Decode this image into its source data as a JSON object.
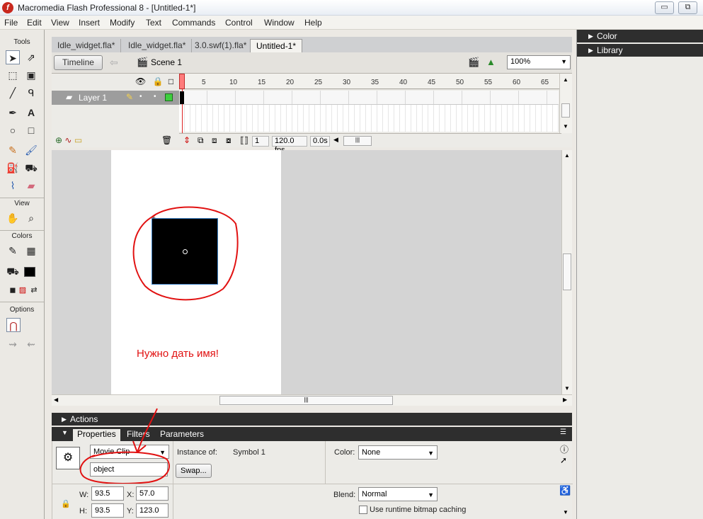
{
  "window": {
    "title": "Macromedia Flash Professional 8 - [Untitled-1*]",
    "controls": [
      "▭",
      "⧉"
    ]
  },
  "menu": [
    "File",
    "Edit",
    "View",
    "Insert",
    "Modify",
    "Text",
    "Commands",
    "Control",
    "Window",
    "Help"
  ],
  "tools_panel": {
    "header_tools": "Tools",
    "header_view": "View",
    "header_colors": "Colors",
    "header_options": "Options",
    "fill_color": "#000000"
  },
  "tabs": [
    {
      "label": "Idle_widget.fla*"
    },
    {
      "label": "Idle_widget.fla*"
    },
    {
      "label": "3.0.swf(1).fla*"
    },
    {
      "label": "Untitled-1*"
    }
  ],
  "editbar": {
    "timeline_label": "Timeline",
    "scene_label": "Scene 1",
    "zoom_value": "100%"
  },
  "timeline": {
    "frame_ticks": [
      "1",
      "5",
      "10",
      "15",
      "20",
      "25",
      "30",
      "35",
      "40",
      "45",
      "50",
      "55",
      "60",
      "65"
    ],
    "layer_name": "Layer 1",
    "current_frame": "1",
    "frame_rate": "120.0 fps",
    "elapsed": "0.0s"
  },
  "stage": {
    "object_color": "#000000",
    "annotation_text": "Нужно дать имя!",
    "annotation_color": "#e11111"
  },
  "actions_panel": {
    "label": "Actions"
  },
  "properties": {
    "tabs": [
      "Properties",
      "Filters",
      "Parameters"
    ],
    "symbol_type": "Movie Clip",
    "instance_name": "object",
    "instance_of_label": "Instance of:",
    "instance_of_value": "Symbol 1",
    "swap_label": "Swap...",
    "color_label": "Color:",
    "color_value": "None",
    "blend_label": "Blend:",
    "blend_value": "Normal",
    "bitmap_caching_label": "Use runtime bitmap caching",
    "w_label": "W:",
    "w_value": "93.5",
    "h_label": "H:",
    "h_value": "93.5",
    "x_label": "X:",
    "x_value": "57.0",
    "y_label": "Y:",
    "y_value": "123.0"
  },
  "right_panels": [
    {
      "label": "Color"
    },
    {
      "label": "Library"
    }
  ]
}
